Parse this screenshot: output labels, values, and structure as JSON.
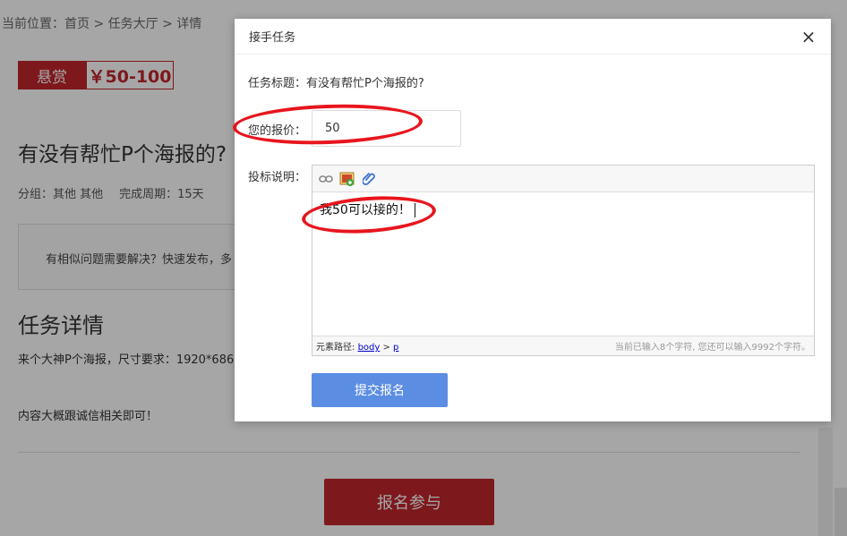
{
  "page": {
    "breadcrumb": "当前位置：首页 > 任务大厅 > 详情",
    "bounty_label": "悬赏",
    "bounty_amount": "￥50-100",
    "task_title": "有没有帮忙P个海报的?",
    "meta_group": "分组：其他 其他",
    "meta_period": "完成周期：15天",
    "similar_notice": "有相似问题需要解决？快速发布，多",
    "section_title": "任务详情",
    "detail_line1": "来个大神P个海报，尺寸要求：1920*686",
    "detail_line2": "内容大概跟诚信相关即可！",
    "signup_label": "报名参与"
  },
  "modal": {
    "title": "接手任务",
    "close": "×",
    "task_title_label": "任务标题：",
    "task_title_value": "有没有帮忙P个海报的?",
    "price_label": "您的报价：",
    "price_value": "50",
    "desc_label": "投标说明：",
    "editor_text": "我50可以接的！",
    "path_label": "元素路径: ",
    "path_body": "body",
    "path_sep": " > ",
    "path_p": "p",
    "counter": "当前已输入8个字符, 您还可以输入9992个字符。",
    "submit_label": "提交报名",
    "toolbar_icons": [
      "link-icon",
      "image-icon",
      "attachment-icon"
    ]
  },
  "colors": {
    "brand_red": "#c0252d",
    "submit_blue": "#5b8de3",
    "annotation_red": "#e8151d"
  }
}
